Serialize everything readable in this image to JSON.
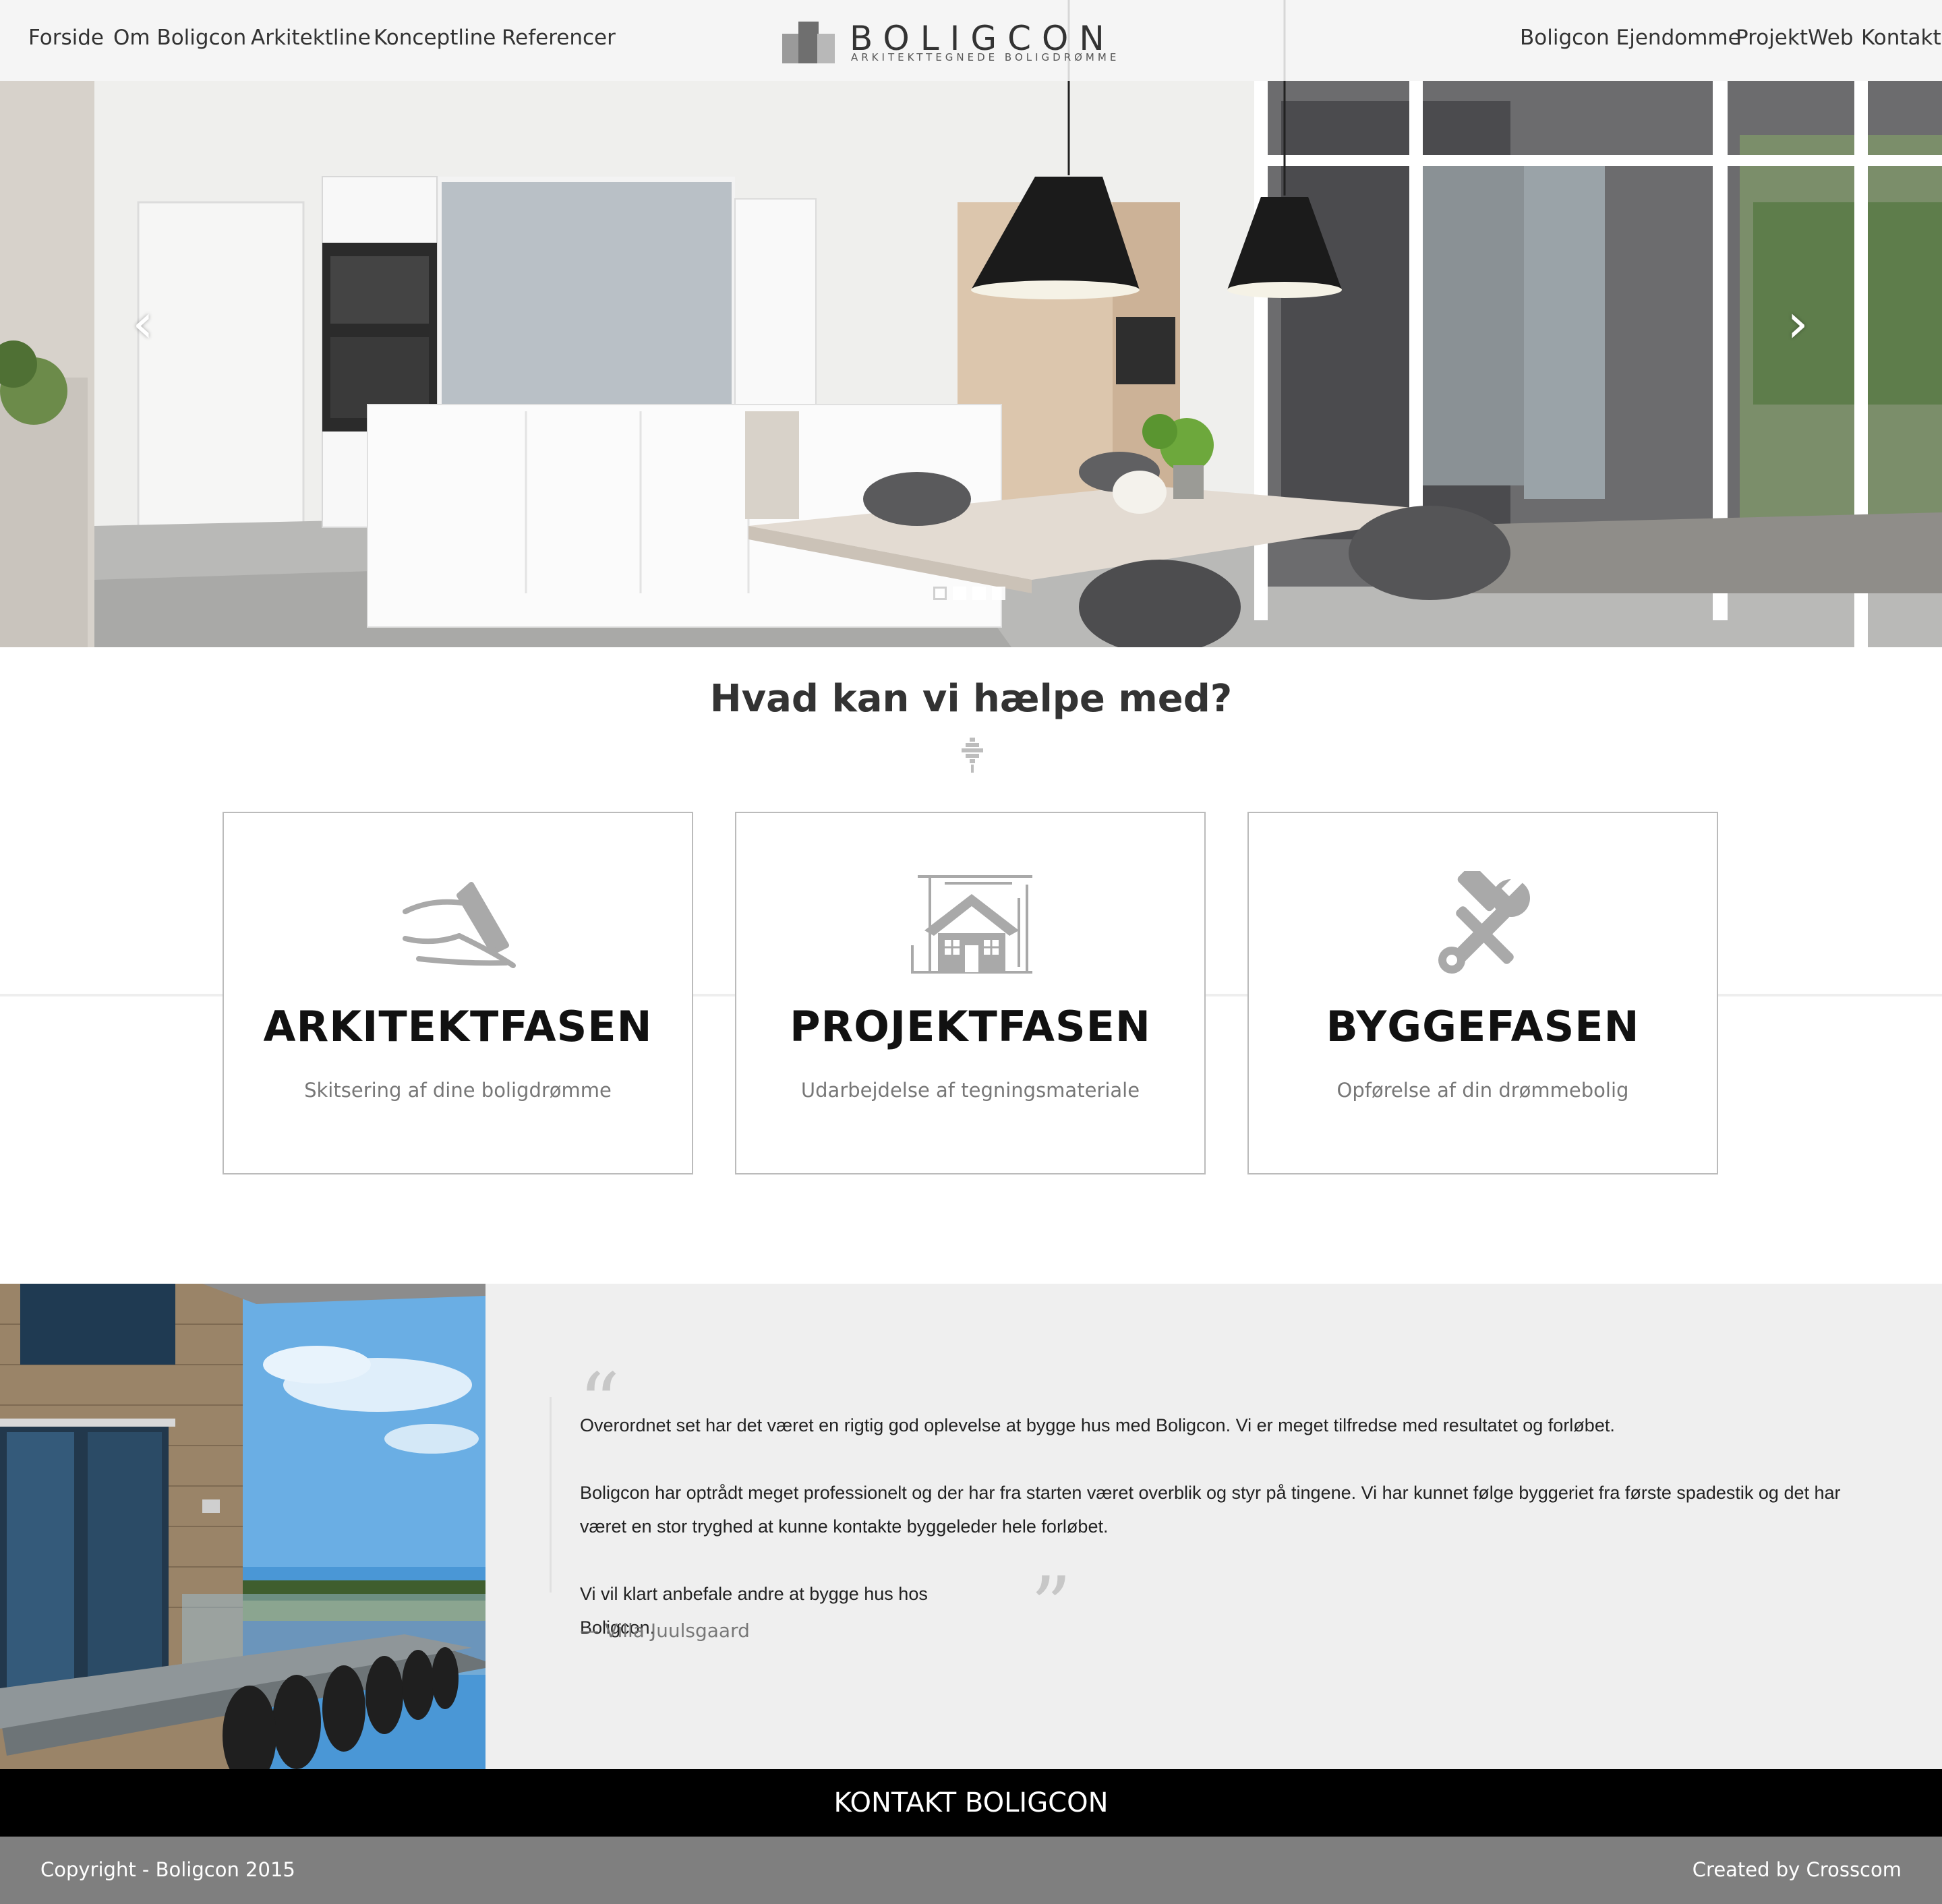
{
  "nav": {
    "left": [
      "Forside",
      "Om Boligcon",
      "Arkitektline",
      "Konceptline",
      "Referencer"
    ],
    "right": [
      "Boligcon Ejendomme",
      "ProjektWeb",
      "Kontakt"
    ]
  },
  "logo": {
    "name": "BOLIGCON",
    "tagline": "ARKITEKTTEGNEDE BOLIGDRØMME"
  },
  "hero": {
    "prev_icon": "chevron-left-icon",
    "next_icon": "chevron-right-icon",
    "slide_count": 4,
    "active_slide": 1
  },
  "services": {
    "title": "Hvad kan vi hælpe med?",
    "cards": [
      {
        "title": "ARKITEKTFASEN",
        "subtitle": "Skitsering af dine boligdrømme",
        "icon": "hand-sketch-icon"
      },
      {
        "title": "PROJEKTFASEN",
        "subtitle": "Udarbejdelse af tegningsmateriale",
        "icon": "house-blueprint-icon"
      },
      {
        "title": "BYGGEFASEN",
        "subtitle": "Opførelse af din drømmebolig",
        "icon": "tools-icon"
      }
    ]
  },
  "testimonial": {
    "paragraphs": [
      "Overordnet set har det været en rigtig god oplevelse at bygge hus med Boligcon. Vi er meget tilfredse med resultatet og forløbet.",
      "Boligcon har optrådt meget professionelt og der har fra starten været overblik og styr på tingene. Vi har kunnet følge byggeriet fra første spadestik og det har været en stor tryghed at kunne kontakte byggeleder hele forløbet.",
      "Vi vil klart anbefale andre at bygge hus hos Boligcon."
    ],
    "author": "— Villa Juulsgaard",
    "open_quote": "“",
    "close_quote": "”"
  },
  "cta": {
    "label": "KONTAKT BOLIGCON"
  },
  "footer": {
    "copyright": "Copyright - Boligcon 2015",
    "credits": "Created by Crosscom"
  }
}
